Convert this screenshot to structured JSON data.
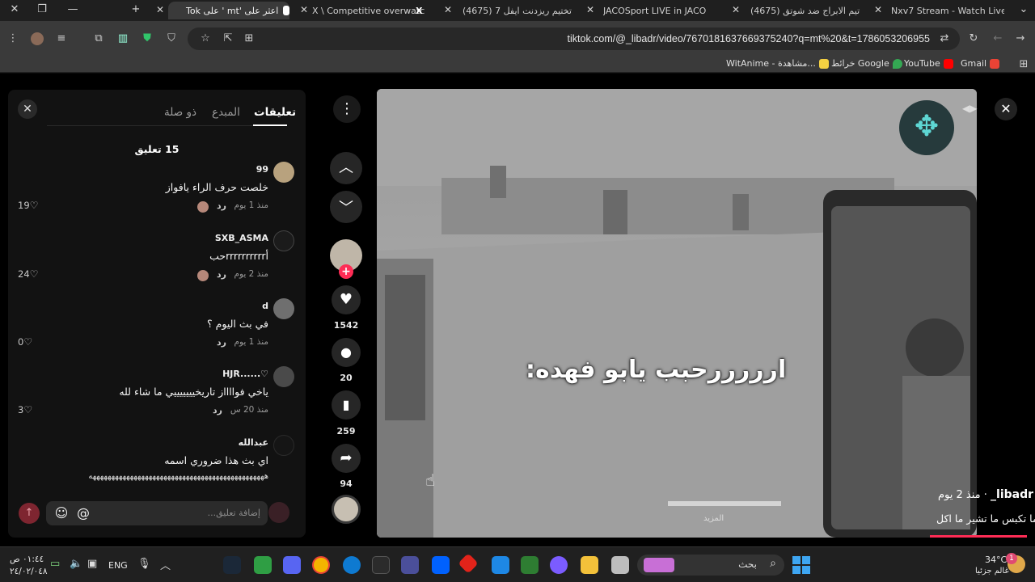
{
  "browser": {
    "tabs": [
      {
        "title": "Tok على ' mt' اعثر على",
        "favicon_color": "#ffffff",
        "active": true
      },
      {
        "title": "X \\ Competitive overwatch",
        "favicon_color": "#ffffff",
        "active": false
      },
      {
        "title": "(4675) تختيم ريزدنت ايفل 7",
        "favicon_color": "#ff0000",
        "active": false
      },
      {
        "title": "JACOSport LIVE in JACO -",
        "favicon_color": "#9146ff",
        "active": false
      },
      {
        "title": "(4675) تيم الابراج ضد شوتق",
        "favicon_color": "#ff0000",
        "active": false
      },
      {
        "title": "Nxv7 Stream - Watch Live",
        "favicon_color": "#53fc18",
        "active": false
      }
    ],
    "url": "tiktok.com/@_libadr/video/7670181637669375240?q=mt%20&t=1786053206955",
    "bookmarks": [
      {
        "label": "Gmail",
        "color": "#ea4335"
      },
      {
        "label": "YouTube",
        "color": "#ff0000"
      },
      {
        "label": "خرائط Google",
        "color": "#34a853"
      },
      {
        "label": "WitAnime - مشاهدة...",
        "color": "#f5d142"
      }
    ]
  },
  "comments_panel": {
    "tabs": [
      "تعليقات",
      "المبدع",
      "ذو صلة"
    ],
    "active_tab": "تعليقات",
    "count_label": "15 تعليق",
    "reply_label": "رد",
    "comments": [
      {
        "username": "99",
        "text": "خلصت حرف الراء يافواز",
        "time": "منذ 1 يوم",
        "likes": "19",
        "avatar_color": "#b8a27e",
        "creator_liked": true
      },
      {
        "username": "SXB_ASMA",
        "text": "أrrrrrrrrrrحب",
        "time": "منذ 2 يوم",
        "likes": "24",
        "avatar_color": "#1b1b1b",
        "creator_liked": true
      },
      {
        "username": "d",
        "text": "في بث اليوم ؟",
        "time": "منذ 1 يوم",
        "likes": "0",
        "avatar_color": "#6f6f6f",
        "creator_liked": false
      },
      {
        "username": "HJR......♡",
        "text": "ياخي فوااااز تاريخيييييييي ما شاء لله",
        "time": "منذ 20 س",
        "likes": "3",
        "avatar_color": "#4a4a4a",
        "creator_liked": false
      },
      {
        "username": "عبدالله",
        "text": "اي بث هذا ضروري اسمه",
        "time": "",
        "likes": "",
        "avatar_color": "#151515",
        "creator_liked": false
      }
    ],
    "overflow_text": "هههههههههههههههههههههههههههههههههههههههههههههههه",
    "input_placeholder": "إضافة تعليق..."
  },
  "actions": {
    "likes": "1542",
    "comments": "20",
    "saves": "259",
    "shares": "94"
  },
  "video": {
    "caption": "ارررررحبب يابو فهده:",
    "author": "_libadr",
    "posted": "منذ 2 يوم",
    "description": "ما تكبس ما تشير ما اكل",
    "more_label": "المزيد"
  },
  "taskbar": {
    "weather_temp": "34°C",
    "weather_desc": "غالم جزئيا",
    "search_placeholder": "بحث",
    "lang": "ENG",
    "time": "٠١:٤٤ ص",
    "date": "٢٤/٠٢/٠٤٨",
    "notification_count": "1"
  }
}
